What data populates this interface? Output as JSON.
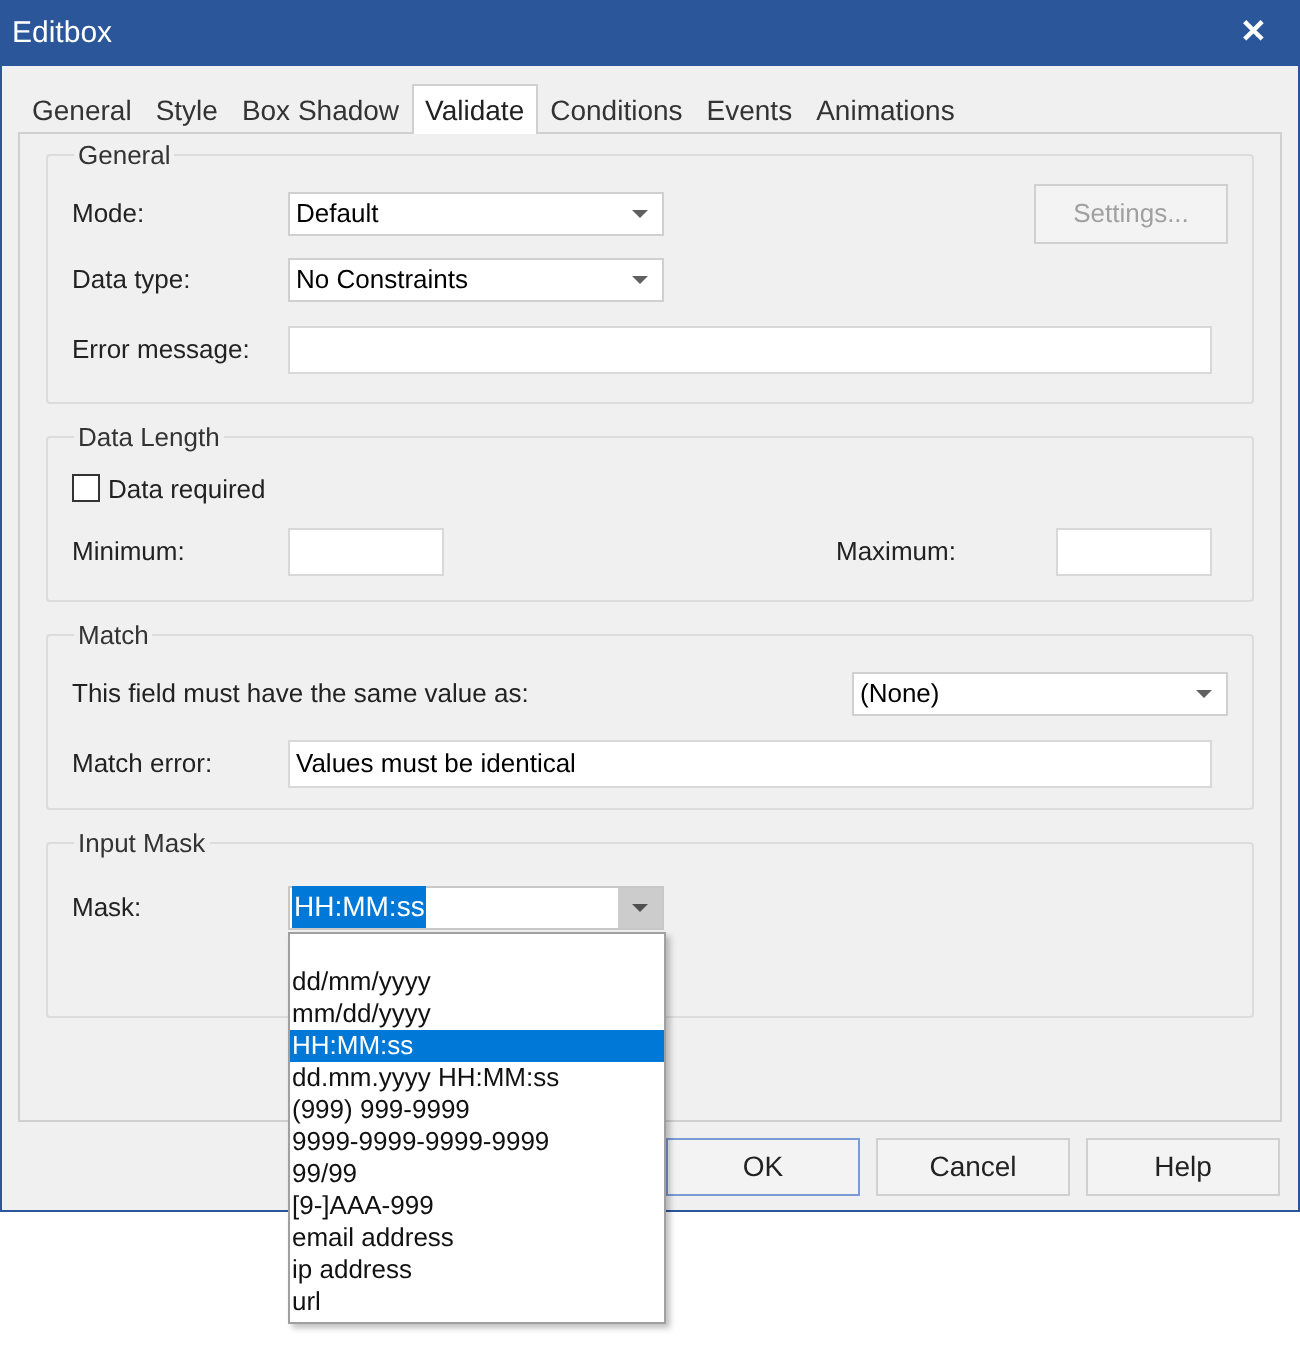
{
  "window": {
    "title": "Editbox",
    "close": "✕"
  },
  "tabs": [
    {
      "label": "General",
      "selected": false
    },
    {
      "label": "Style",
      "selected": false
    },
    {
      "label": "Box Shadow",
      "selected": false
    },
    {
      "label": "Validate",
      "selected": true
    },
    {
      "label": "Conditions",
      "selected": false
    },
    {
      "label": "Events",
      "selected": false
    },
    {
      "label": "Animations",
      "selected": false
    }
  ],
  "general": {
    "title": "General",
    "mode": {
      "label": "Mode:",
      "value": "Default"
    },
    "data_type": {
      "label": "Data type:",
      "value": "No Constraints"
    },
    "error_message": {
      "label": "Error message:"
    },
    "settings_button": {
      "label": "Settings...",
      "disabled": true
    }
  },
  "data_length": {
    "title": "Data Length",
    "data_required": {
      "label": "Data required",
      "checked": false
    },
    "minimum": {
      "label": "Minimum:"
    },
    "maximum": {
      "label": "Maximum:"
    }
  },
  "match": {
    "title": "Match",
    "same_value": {
      "label": "This field must have the same value as:",
      "value": "(None)"
    },
    "match_error": {
      "label": "Match error:",
      "value": "Values must be identical"
    }
  },
  "input_mask": {
    "title": "Input Mask",
    "mask": {
      "label": "Mask:",
      "value": "HH:MM:ss",
      "expanded": true,
      "options": [
        {
          "label": "dd/mm/yyyy",
          "selected": false
        },
        {
          "label": "mm/dd/yyyy",
          "selected": false
        },
        {
          "label": "HH:MM:ss",
          "selected": true
        },
        {
          "label": "dd.mm.yyyy HH:MM:ss",
          "selected": false
        },
        {
          "label": "(999) 999-9999",
          "selected": false
        },
        {
          "label": "9999-9999-9999-9999",
          "selected": false
        },
        {
          "label": "99/99",
          "selected": false
        },
        {
          "label": "[9-]AAA-999",
          "selected": false
        },
        {
          "label": "email address",
          "selected": false
        },
        {
          "label": "ip address",
          "selected": false
        },
        {
          "label": "url",
          "selected": false
        }
      ]
    }
  },
  "buttons": [
    {
      "label": "OK",
      "default": true
    },
    {
      "label": "Cancel",
      "default": false
    },
    {
      "label": "Help",
      "default": false
    }
  ]
}
